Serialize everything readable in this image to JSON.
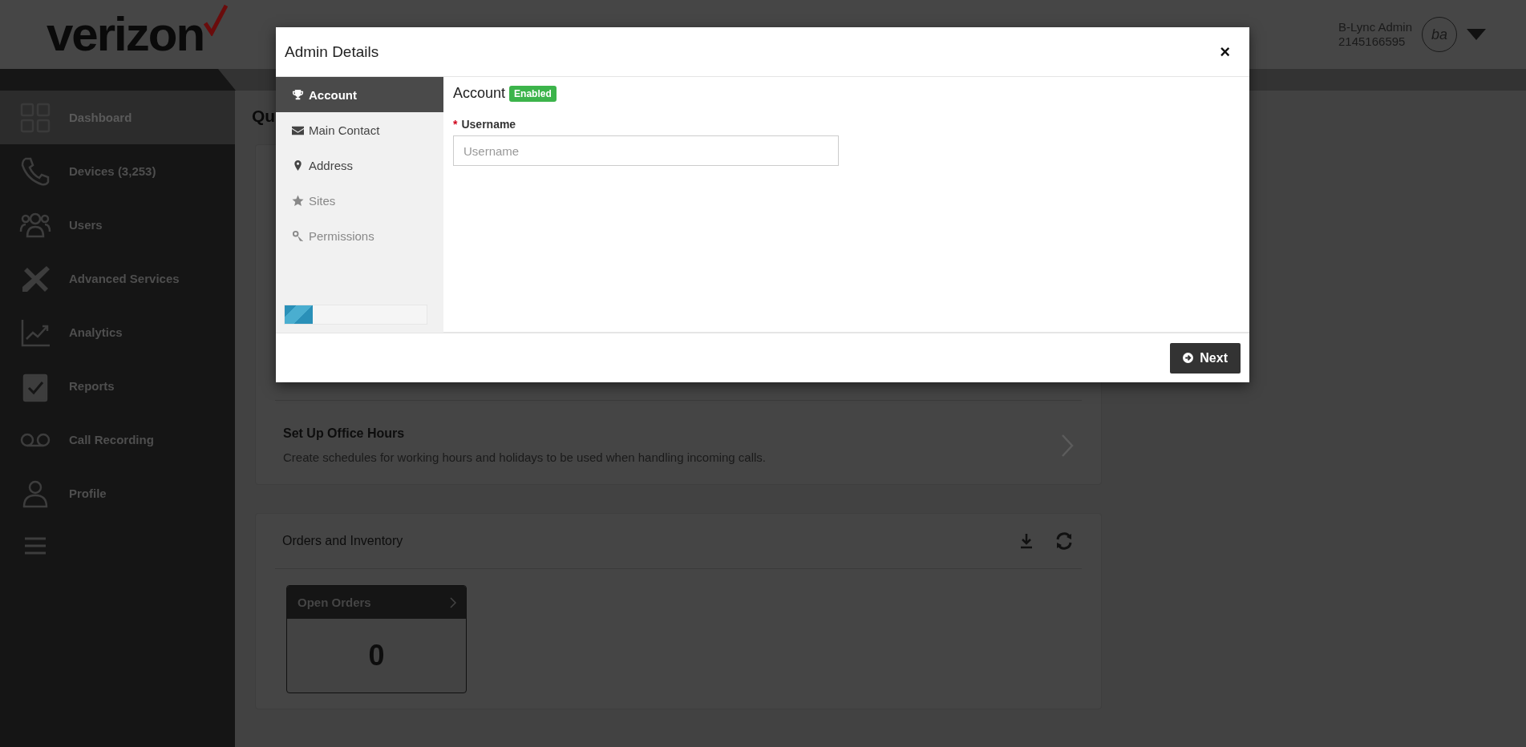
{
  "header": {
    "logo": "verizon",
    "user_name": "B-Lync Admin",
    "user_phone": "2145166595",
    "avatar_initials": "ba"
  },
  "sidebar": {
    "items": [
      {
        "label": "Dashboard",
        "selected": true
      },
      {
        "label": "Devices (3,253)",
        "selected": false
      },
      {
        "label": "Users",
        "selected": false
      },
      {
        "label": "Advanced Services",
        "selected": false
      },
      {
        "label": "Analytics",
        "selected": false
      },
      {
        "label": "Reports",
        "selected": false
      },
      {
        "label": "Call Recording",
        "selected": false
      },
      {
        "label": "Profile",
        "selected": false
      }
    ]
  },
  "quick_actions": {
    "title": "Qu",
    "items": [
      {
        "title": "Set Up Office Hours",
        "description": "Create schedules for working hours and holidays to be used when handling incoming calls."
      }
    ]
  },
  "orders": {
    "title": "Orders and Inventory",
    "tiles": [
      {
        "label": "Open Orders",
        "value": "0"
      }
    ]
  },
  "modal": {
    "title": "Admin Details",
    "close": "×",
    "nav": [
      {
        "label": "Account",
        "selected": true,
        "disabled": false
      },
      {
        "label": "Main Contact",
        "selected": false,
        "disabled": false
      },
      {
        "label": "Address",
        "selected": false,
        "disabled": false
      },
      {
        "label": "Sites",
        "selected": false,
        "disabled": true
      },
      {
        "label": "Permissions",
        "selected": false,
        "disabled": true
      }
    ],
    "progress": {
      "level": 0.2
    },
    "section": {
      "title": "Account",
      "status": "Enabled"
    },
    "fields": [
      {
        "label": "Username",
        "required_mark": "*",
        "placeholder": "Username"
      }
    ],
    "next_button": "Next"
  }
}
